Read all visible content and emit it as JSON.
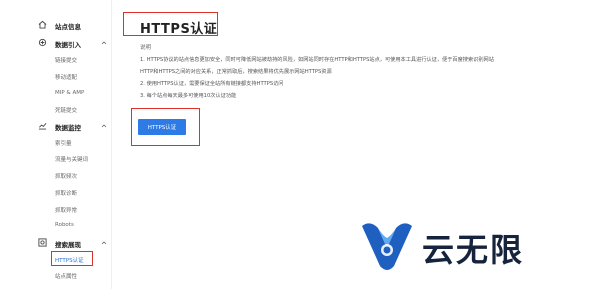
{
  "sidebar": {
    "site_info": "站点信息",
    "data_import": {
      "title": "数据引入",
      "items": [
        "链接提交",
        "移动适配",
        "MIP & AMP",
        "死链提交"
      ]
    },
    "data_monitor": {
      "title": "数据监控",
      "items": [
        "索引量",
        "流量与关键词",
        "抓取频次",
        "抓取诊断",
        "抓取异常",
        "Robots"
      ]
    },
    "search_display": {
      "title": "搜索展现",
      "items": [
        "HTTPS认证",
        "站点属性"
      ]
    }
  },
  "main": {
    "title": "HTTPS认证",
    "desc_title": "说明",
    "desc_lines": [
      "1. HTTPS协议的站点信息更加安全，同时可降低网站被劫持的风险，如网站同时存在HTTP和HTTPS站点，可使用本工具进行认证，便于百度搜索识别网站",
      "HTTP和HTTPS之间的对应关系，正常抓取后，搜索结果将优先展示网站HTTPS资源",
      "2. 使用HTTPS认证，需要保证全站所有链接都支持HTTPS访问",
      "3. 每个站点每天最多可使用10次认证功能"
    ],
    "button": "HTTPS认证"
  },
  "watermark": {
    "text": "云无限"
  },
  "colors": {
    "accent": "#2f7be6",
    "highlight": "#d9342b",
    "active_link": "#2a6fd6"
  }
}
